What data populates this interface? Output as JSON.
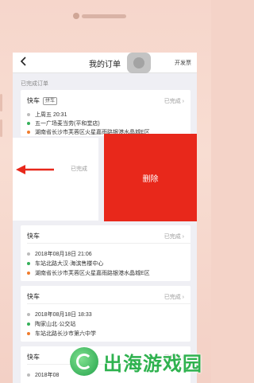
{
  "nav": {
    "back_icon": "chevron-left-icon",
    "title": "我的订单",
    "invoice_label": "开发票"
  },
  "section_title": "已完成订单",
  "orders": [
    {
      "type": "快车",
      "tag": "拼车",
      "status": "已完成 ›",
      "time": "上周五 20:31",
      "start": "五一广场麦当劳(平和堂店)",
      "end": "湖南省长沙市芙蓉区火星嘉雨路银港水晶城E区"
    },
    {
      "status": "已完成",
      "delete_label": "删除"
    },
    {
      "type": "快车",
      "status": "已完成 ›",
      "time": "2018年08月18日 21:06",
      "start": "车站北路大汉·海滨售楼中心",
      "end": "湖南省长沙市芙蓉区火星嘉雨路银港水晶城E区"
    },
    {
      "type": "快车",
      "status": "已完成 ›",
      "time": "2018年08月18日 18:33",
      "start": "陶家山北·公交站",
      "end": "车站北路长沙市第六中学"
    },
    {
      "type": "快车",
      "status": "已完成 ›",
      "time": "2018年08"
    }
  ],
  "watermark": {
    "text": "出海游戏园"
  },
  "colors": {
    "delete_bg": "#e8281b",
    "start_dot": "#35b05a",
    "end_dot": "#f07c2e",
    "phone_frame": "#f6d6cb"
  }
}
